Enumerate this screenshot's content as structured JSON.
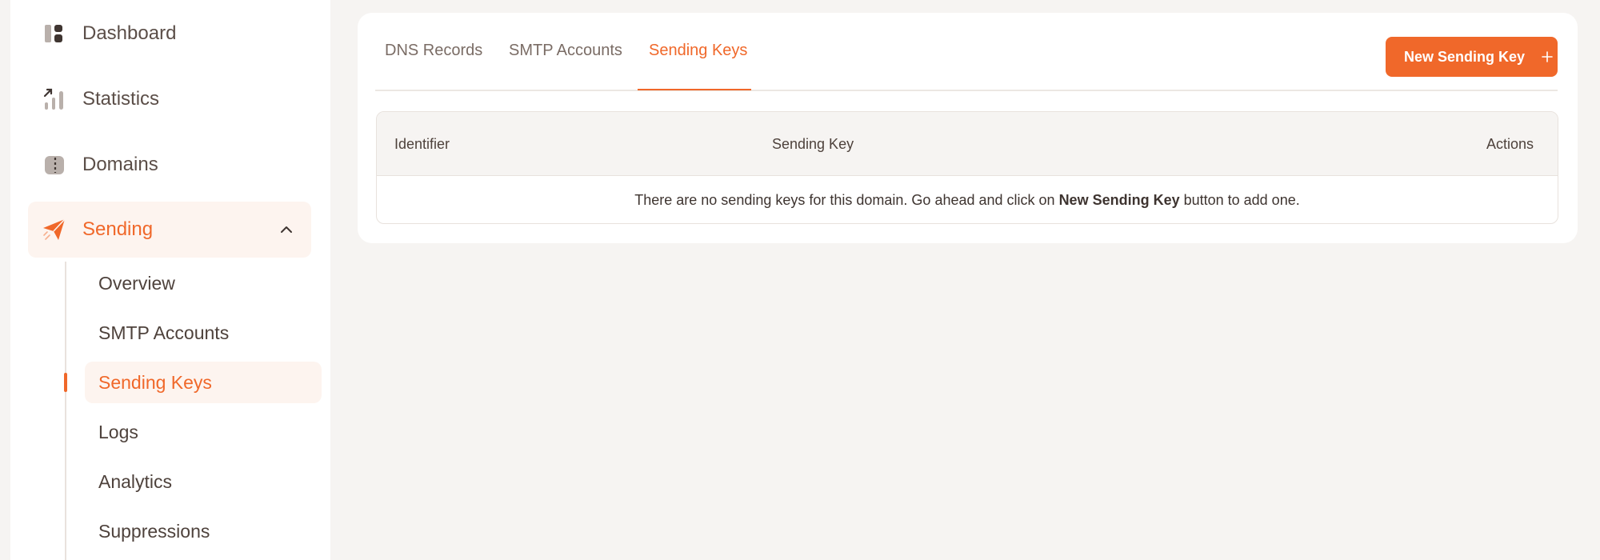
{
  "sidebar": {
    "items": [
      {
        "label": "Dashboard",
        "icon": "dashboard-icon"
      },
      {
        "label": "Statistics",
        "icon": "statistics-icon"
      },
      {
        "label": "Domains",
        "icon": "domains-icon"
      },
      {
        "label": "Sending",
        "icon": "paper-plane-icon",
        "expanded": true
      }
    ],
    "sub_items": [
      {
        "label": "Overview"
      },
      {
        "label": "SMTP Accounts"
      },
      {
        "label": "Sending Keys",
        "active": true
      },
      {
        "label": "Logs"
      },
      {
        "label": "Analytics"
      },
      {
        "label": "Suppressions"
      }
    ]
  },
  "tabs": [
    {
      "label": "DNS Records"
    },
    {
      "label": "SMTP Accounts"
    },
    {
      "label": "Sending Keys",
      "active": true
    }
  ],
  "new_button": {
    "label": "New Sending Key"
  },
  "table": {
    "columns": [
      "Identifier",
      "Sending Key",
      "Actions"
    ],
    "empty": {
      "prefix": "There are no sending keys for this domain. Go ahead and click on ",
      "emphasis": "New Sending Key",
      "suffix": " button to add one."
    }
  },
  "colors": {
    "accent": "#f0682a",
    "accent_soft": "#fdf4ef",
    "background": "#f6f4f2",
    "text": "#4e423c"
  }
}
